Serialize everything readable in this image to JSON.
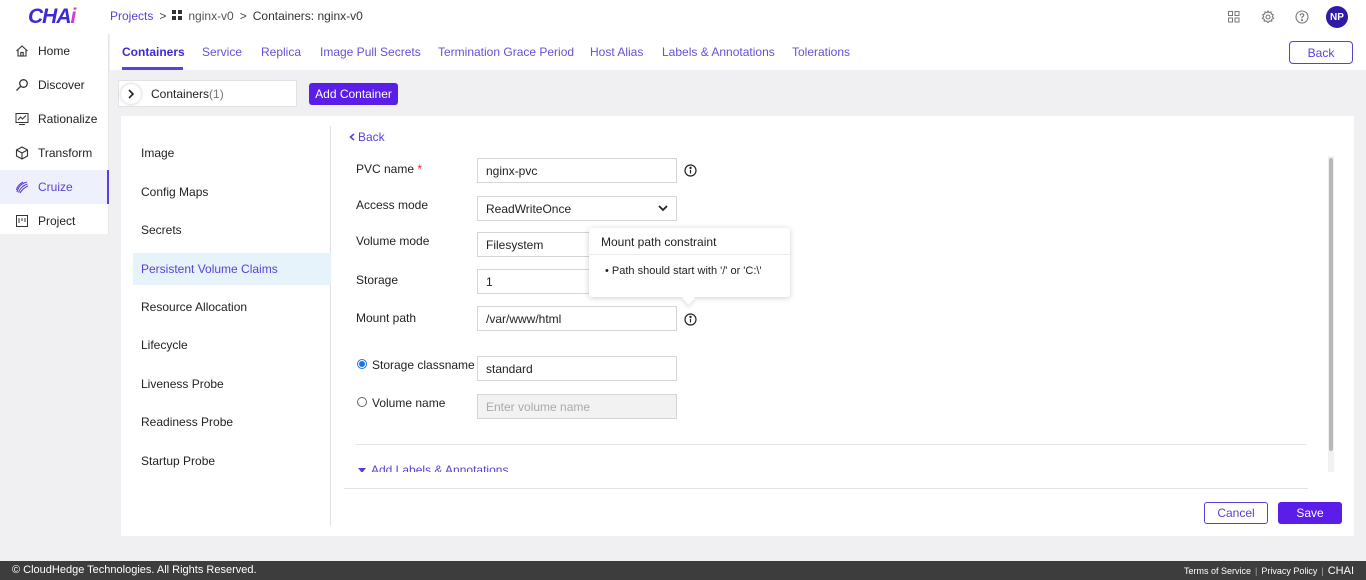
{
  "header": {
    "logo_main": "CHA",
    "logo_accent": "i",
    "breadcrumb": {
      "projects": "Projects",
      "sep1": ">",
      "project": "nginx-v0",
      "sep2": ">",
      "current": "Containers: nginx-v0"
    },
    "avatar_initials": "NP",
    "icons": [
      "grid-icon",
      "gear-icon",
      "help-icon"
    ]
  },
  "sidebar": {
    "items": [
      {
        "label": "Home",
        "icon": "home-icon"
      },
      {
        "label": "Discover",
        "icon": "discover-icon"
      },
      {
        "label": "Rationalize",
        "icon": "rationalize-icon"
      },
      {
        "label": "Transform",
        "icon": "cube-icon"
      },
      {
        "label": "Cruize",
        "icon": "cruize-icon",
        "active": true
      },
      {
        "label": "Project",
        "icon": "project-icon"
      }
    ]
  },
  "tabs": {
    "items": [
      "Containers",
      "Service",
      "Replica",
      "Image Pull Secrets",
      "Termination Grace Period",
      "Host Alias",
      "Labels & Annotations",
      "Tolerations"
    ],
    "active": "Containers",
    "back_label": "Back"
  },
  "containers": {
    "label": "Containers",
    "count": "(1)",
    "add_label": "Add Container"
  },
  "leftnav": {
    "items": [
      "Image",
      "Config Maps",
      "Secrets",
      "Persistent Volume Claims",
      "Resource Allocation",
      "Lifecycle",
      "Liveness Probe",
      "Readiness Probe",
      "Startup Probe"
    ],
    "active": "Persistent Volume Claims"
  },
  "form": {
    "back_label": "Back",
    "pvc_name": {
      "label": "PVC name",
      "required": "*",
      "value": "nginx-pvc"
    },
    "access_mode": {
      "label": "Access mode",
      "value": "ReadWriteOnce"
    },
    "volume_mode": {
      "label": "Volume mode",
      "value": "Filesystem"
    },
    "storage": {
      "label": "Storage",
      "value": "1"
    },
    "mount_path": {
      "label": "Mount path",
      "value": "/var/www/html"
    },
    "storage_classname": {
      "label": "Storage classname",
      "value": "standard",
      "selected": true
    },
    "volume_name": {
      "label": "Volume name",
      "placeholder": "Enter volume name"
    },
    "add_labels": "Add Labels & Annotations",
    "cancel_label": "Cancel",
    "save_label": "Save"
  },
  "tooltip": {
    "title": "Mount path constraint",
    "item": "Path should start with '/' or 'C:\\'"
  },
  "footer": {
    "copyright": "© CloudHedge Technologies. All Rights Reserved.",
    "terms": "Terms of Service",
    "privacy": "Privacy Policy",
    "brand": "CHAI"
  },
  "colors": {
    "accent": "#5b3fd8",
    "primary_button": "#5b1de8",
    "footer_bg": "#3d3d3d"
  }
}
